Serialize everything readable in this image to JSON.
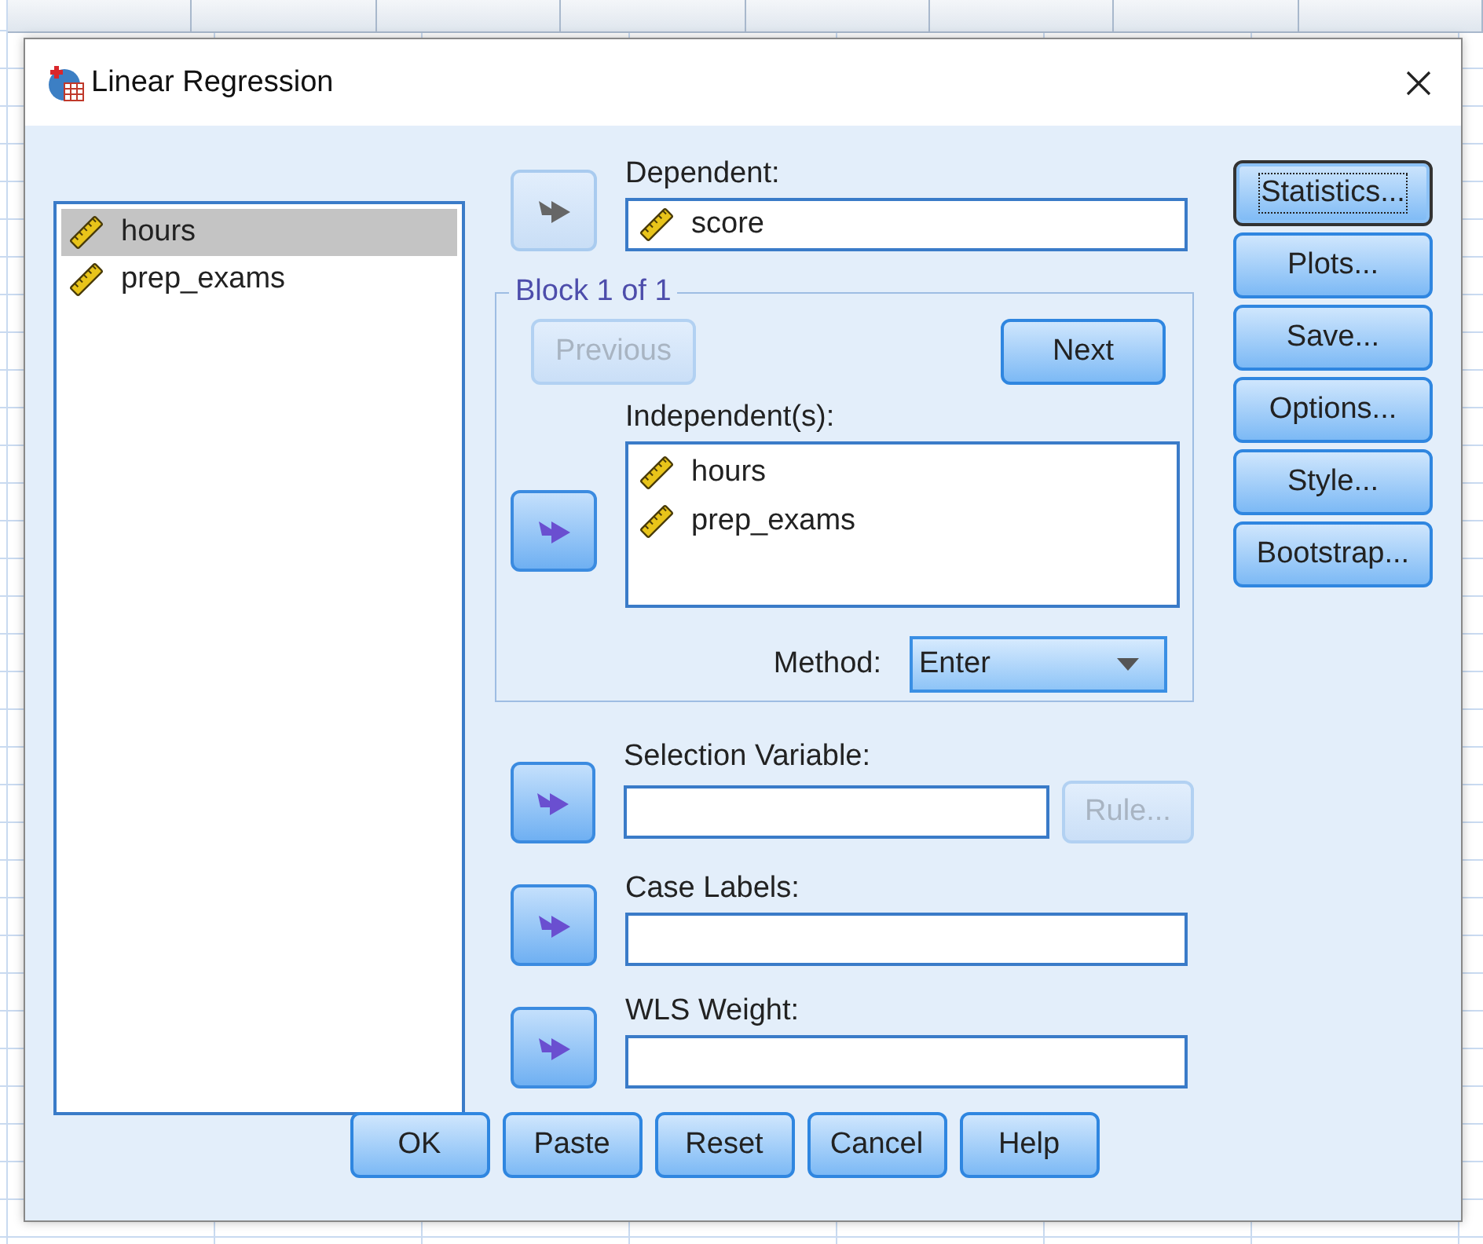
{
  "window": {
    "title": "Linear Regression"
  },
  "variable_list": [
    {
      "name": "hours",
      "selected": true
    },
    {
      "name": "prep_exams",
      "selected": false
    }
  ],
  "dependent": {
    "label": "Dependent:",
    "arrow_disabled": true,
    "variables": [
      "score"
    ]
  },
  "block": {
    "title": "Block 1 of 1",
    "previous": {
      "label": "Previous",
      "disabled": true
    },
    "next": {
      "label": "Next",
      "disabled": false
    },
    "independents": {
      "label": "Independent(s):",
      "arrow_disabled": false,
      "variables": [
        "hours",
        "prep_exams"
      ]
    },
    "method": {
      "label": "Method:",
      "value": "Enter"
    }
  },
  "selection_variable": {
    "label": "Selection Variable:",
    "arrow_disabled": false,
    "rule": {
      "label": "Rule...",
      "disabled": true
    }
  },
  "case_labels": {
    "label": "Case Labels:",
    "arrow_disabled": false
  },
  "wls_weight": {
    "label": "WLS Weight:",
    "arrow_disabled": false
  },
  "side_buttons": [
    {
      "label": "Statistics...",
      "focused": true
    },
    {
      "label": "Plots...",
      "focused": false
    },
    {
      "label": "Save...",
      "focused": false
    },
    {
      "label": "Options...",
      "focused": false
    },
    {
      "label": "Style...",
      "focused": false
    },
    {
      "label": "Bootstrap...",
      "focused": false
    }
  ],
  "buttons": [
    {
      "label": "OK"
    },
    {
      "label": "Paste"
    },
    {
      "label": "Reset"
    },
    {
      "label": "Cancel"
    },
    {
      "label": "Help"
    }
  ]
}
